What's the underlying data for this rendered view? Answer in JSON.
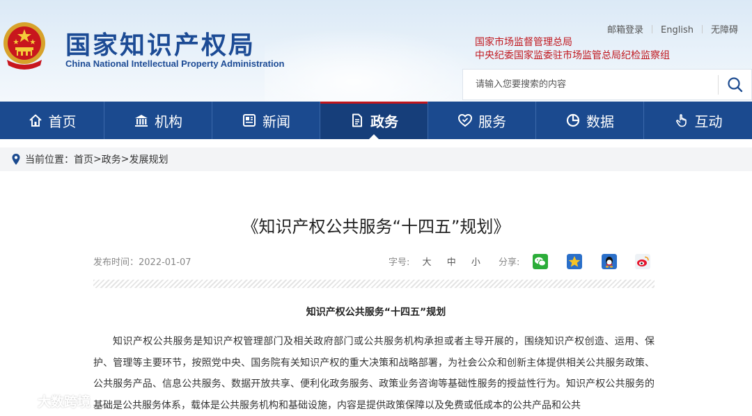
{
  "header": {
    "logo_cn": "国家知识产权局",
    "logo_en": "China National Intellectual Property Administration",
    "top_links": [
      "邮箱登录",
      "English",
      "无障碍"
    ],
    "red_links": [
      "国家市场监督管理总局",
      "中央纪委国家监委驻市场监管总局纪检监察组"
    ],
    "search_placeholder": "请输入您要搜索的内容"
  },
  "nav": {
    "items": [
      {
        "label": "首页",
        "icon": "home-icon"
      },
      {
        "label": "机构",
        "icon": "building-icon"
      },
      {
        "label": "新闻",
        "icon": "newspaper-icon"
      },
      {
        "label": "政务",
        "icon": "document-icon",
        "active": true
      },
      {
        "label": "服务",
        "icon": "heart-check-icon"
      },
      {
        "label": "数据",
        "icon": "pie-chart-icon"
      },
      {
        "label": "互动",
        "icon": "hand-pointer-icon"
      }
    ],
    "bg_color": "#1b4a8f",
    "active_color": "#c0161d"
  },
  "breadcrumb": {
    "prefix": "当前位置：",
    "items": [
      "首页",
      "政务",
      "发展规划"
    ],
    "separator": ">"
  },
  "article": {
    "title": "《知识产权公共服务“十四五”规划》",
    "publish_label": "发布时间：",
    "publish_date": "2022-01-07",
    "fontsize_label": "字号:",
    "fontsize_options": [
      "大",
      "中",
      "小"
    ],
    "share_label": "分享:",
    "share_icons": [
      "wechat-icon",
      "qzone-icon",
      "qq-icon",
      "weibo-icon"
    ],
    "subtitle": "知识产权公共服务“十四五”规划",
    "paragraph": "知识产权公共服务是知识产权管理部门及相关政府部门或公共服务机构承担或者主导开展的，围绕知识产权创造、运用、保护、管理等主要环节，按照党中央、国务院有关知识产权的重大决策和战略部署，为社会公众和创新主体提供相关公共服务政策、公共服务产品、信息公共服务、数据开放共享、便利化政务服务、政策业务咨询等基础性服务的授益性行为。知识产权公共服务的基础是公共服务体系，载体是公共服务机构和基础设施，内容是提供政策保障以及免费或低成本的公共产品和公共"
  },
  "watermark": "大数跨境"
}
